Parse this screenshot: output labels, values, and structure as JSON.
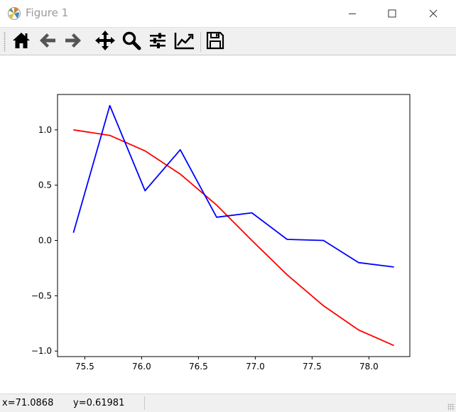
{
  "window": {
    "title": "Figure 1",
    "icon": "matplotlib-icon",
    "controls": [
      "minimize-icon",
      "maximize-icon",
      "close-icon"
    ]
  },
  "toolbar": {
    "buttons": [
      {
        "name": "home-button",
        "icon": "home-icon"
      },
      {
        "name": "back-button",
        "icon": "arrow-left-icon"
      },
      {
        "name": "forward-button",
        "icon": "arrow-right-icon"
      },
      {
        "name": "pan-button",
        "icon": "move-icon"
      },
      {
        "name": "zoom-button",
        "icon": "zoom-icon"
      },
      {
        "name": "configure-subplots-button",
        "icon": "sliders-icon"
      },
      {
        "name": "edit-axis-button",
        "icon": "line-chart-icon"
      },
      {
        "name": "save-button",
        "icon": "save-icon"
      }
    ]
  },
  "status": {
    "x_readout": "x=71.0868",
    "y_readout": "y=0.61981"
  },
  "chart_data": {
    "type": "line",
    "xlim": [
      75.26,
      78.36
    ],
    "ylim": [
      -1.05,
      1.32
    ],
    "xticks": [
      75.5,
      76.0,
      76.5,
      77.0,
      77.5,
      78.0
    ],
    "xtick_labels": [
      "75.5",
      "76.0",
      "76.5",
      "77.0",
      "77.5",
      "78.0"
    ],
    "yticks": [
      -1.0,
      -0.5,
      0.0,
      0.5,
      1.0
    ],
    "ytick_labels": [
      "−1.0",
      "−0.5",
      "0.0",
      "0.5",
      "1.0"
    ],
    "grid": false,
    "series": [
      {
        "color": "#ff0000",
        "x": [
          75.4,
          75.72,
          76.03,
          76.34,
          76.66,
          76.97,
          77.28,
          77.6,
          77.91,
          78.22
        ],
        "y": [
          1.0,
          0.95,
          0.81,
          0.6,
          0.32,
          0.0,
          -0.31,
          -0.59,
          -0.81,
          -0.95
        ]
      },
      {
        "color": "#0000ff",
        "x": [
          75.4,
          75.72,
          76.03,
          76.34,
          76.66,
          76.97,
          77.28,
          77.6,
          77.91,
          78.22
        ],
        "y": [
          0.07,
          1.22,
          0.45,
          0.82,
          0.21,
          0.25,
          0.01,
          0.0,
          -0.2,
          -0.24
        ]
      }
    ]
  }
}
